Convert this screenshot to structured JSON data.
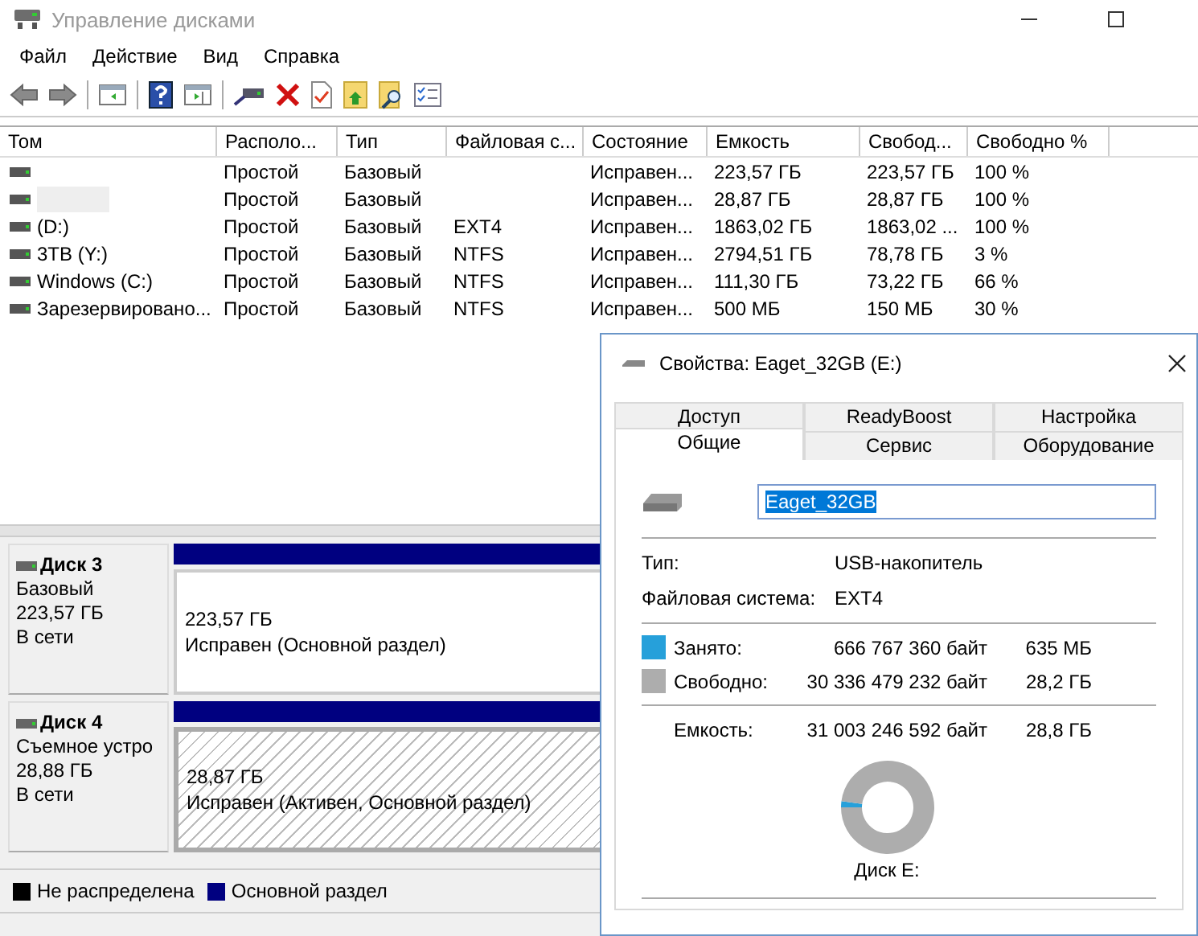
{
  "window": {
    "title": "Управление дисками"
  },
  "menu": [
    "Файл",
    "Действие",
    "Вид",
    "Справка"
  ],
  "volumes": {
    "columns": [
      "Том",
      "Располо...",
      "Тип",
      "Файловая с...",
      "Состояние",
      "Емкость",
      "Свобод...",
      "Свободно %"
    ],
    "rows": [
      {
        "redacted": false,
        "cells": [
          "",
          "Простой",
          "Базовый",
          "",
          "Исправен...",
          "223,57 ГБ",
          "223,57 ГБ",
          "100 %"
        ]
      },
      {
        "redacted": true,
        "cells": [
          "",
          "Простой",
          "Базовый",
          "",
          "Исправен...",
          "28,87 ГБ",
          "28,87 ГБ",
          "100 %"
        ]
      },
      {
        "redacted": false,
        "cells": [
          "(D:)",
          "Простой",
          "Базовый",
          "EXT4",
          "Исправен...",
          "1863,02 ГБ",
          "1863,02 ...",
          "100 %"
        ]
      },
      {
        "redacted": false,
        "cells": [
          "3TB (Y:)",
          "Простой",
          "Базовый",
          "NTFS",
          "Исправен...",
          "2794,51 ГБ",
          "78,78 ГБ",
          "3 %"
        ]
      },
      {
        "redacted": false,
        "cells": [
          "Windows (C:)",
          "Простой",
          "Базовый",
          "NTFS",
          "Исправен...",
          "111,30 ГБ",
          "73,22 ГБ",
          "66 %"
        ]
      },
      {
        "redacted": false,
        "cells": [
          "Зарезервировано...",
          "Простой",
          "Базовый",
          "NTFS",
          "Исправен...",
          "500 МБ",
          "150 МБ",
          "30 %"
        ]
      }
    ]
  },
  "disks": [
    {
      "name": "Диск 3",
      "type": "Базовый",
      "size": "223,57 ГБ",
      "status": "В сети",
      "partition": {
        "size": "223,57 ГБ",
        "status": "Исправен (Основной раздел)",
        "selected": false
      }
    },
    {
      "name": "Диск 4",
      "type": "Съемное устро",
      "size": "28,88 ГБ",
      "status": "В сети",
      "partition": {
        "size": "28,87 ГБ",
        "status": "Исправен (Активен, Основной раздел)",
        "selected": true
      }
    }
  ],
  "legend": [
    {
      "label": "Не распределена",
      "color": "#000000"
    },
    {
      "label": "Основной раздел",
      "color": "#000080"
    }
  ],
  "dialog": {
    "title": "Свойства: Eaget_32GB (E:)",
    "tab_rows": [
      [
        {
          "label": "Доступ",
          "selected": false
        },
        {
          "label": "ReadyBoost",
          "selected": false
        },
        {
          "label": "Настройка",
          "selected": false
        }
      ],
      [
        {
          "label": "Общие",
          "selected": true
        },
        {
          "label": "Сервис",
          "selected": false
        },
        {
          "label": "Оборудование",
          "selected": false
        }
      ]
    ],
    "name": "Eaget_32GB",
    "info": [
      {
        "label": "Тип:",
        "value": "USB-накопитель"
      },
      {
        "label": "Файловая система:",
        "value": "EXT4"
      }
    ],
    "usage": [
      {
        "label": "Занято:",
        "bytes": "666 767 360 байт",
        "size": "635 МБ",
        "color": "#26a0da"
      },
      {
        "label": "Свободно:",
        "bytes": "30 336 479 232 байт",
        "size": "28,2 ГБ",
        "color": "#adadad"
      }
    ],
    "capacity": {
      "label": "Емкость:",
      "bytes": "31 003 246 592 байт",
      "size": "28,8 ГБ"
    },
    "chart_data": {
      "type": "donut",
      "values": [
        2.15,
        97.85
      ]
    },
    "drive_label": "Диск E:"
  }
}
